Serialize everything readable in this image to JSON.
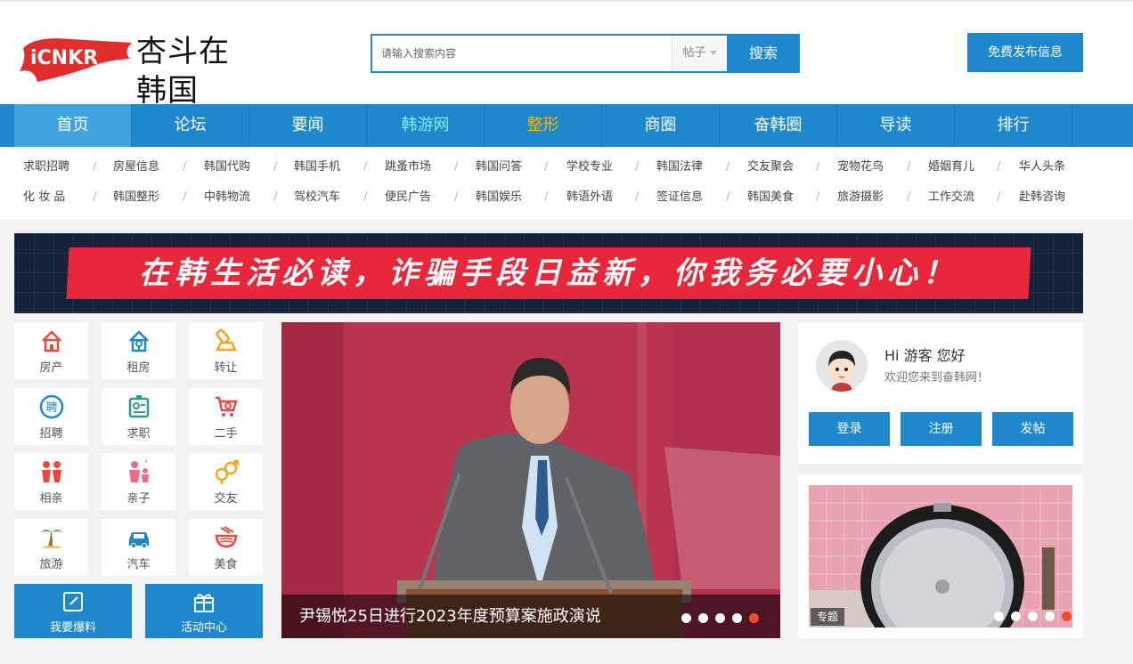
{
  "header": {
    "logo_mark": "iCNKR",
    "logo_text": "杏斗在韩国",
    "search_placeholder": "请输入搜索内容",
    "search_type": "帖子",
    "search_button": "搜索",
    "publish_button": "免费发布信息"
  },
  "nav": {
    "items": [
      {
        "label": "首页",
        "color": "#ffffff"
      },
      {
        "label": "论坛",
        "color": "#ffffff"
      },
      {
        "label": "要闻",
        "color": "#ffffff"
      },
      {
        "label": "韩游网",
        "color": "#7ff1ff"
      },
      {
        "label": "整形",
        "color": "#ffb400"
      },
      {
        "label": "商圈",
        "color": "#ffffff"
      },
      {
        "label": "奋韩圈",
        "color": "#ffffff"
      },
      {
        "label": "导读",
        "color": "#ffffff"
      },
      {
        "label": "排行",
        "color": "#ffffff"
      }
    ]
  },
  "subnav": {
    "row1": [
      "求职招聘",
      "房屋信息",
      "韩国代购",
      "韩国手机",
      "跳蚤市场",
      "韩国问答",
      "学校专业",
      "韩国法律",
      "交友聚会",
      "宠物花鸟",
      "婚姻育儿",
      "华人头条"
    ],
    "row2": [
      "化 妆 品",
      "韩国整形",
      "中韩物流",
      "驾校汽车",
      "便民广告",
      "韩国娱乐",
      "韩语外语",
      "签证信息",
      "韩国美食",
      "旅游摄影",
      "工作交流",
      "赴韩咨询"
    ],
    "separator": "/"
  },
  "banner": {
    "text": "在韩生活必读，诈骗手段日益新，你我务必要小心！"
  },
  "quick_tiles": [
    {
      "label": "房产",
      "icon": "house-icon",
      "color": "#e94a3f"
    },
    {
      "label": "租房",
      "icon": "house-key-icon",
      "color": "#1e88cc"
    },
    {
      "label": "转让",
      "icon": "tools-icon",
      "color": "#f5a623"
    },
    {
      "label": "招聘",
      "icon": "recruit-badge-icon",
      "color": "#1e88cc"
    },
    {
      "label": "求职",
      "icon": "id-card-icon",
      "color": "#2a9d8f"
    },
    {
      "label": "二手",
      "icon": "cart-icon",
      "color": "#e94a3f"
    },
    {
      "label": "相亲",
      "icon": "couple-icon",
      "color": "#e94a3f"
    },
    {
      "label": "亲子",
      "icon": "parent-child-icon",
      "color": "#f06b8a"
    },
    {
      "label": "交友",
      "icon": "gender-icon",
      "color": "#f5a623"
    },
    {
      "label": "旅游",
      "icon": "palm-tree-icon",
      "color": "#4caf50"
    },
    {
      "label": "汽车",
      "icon": "car-icon",
      "color": "#1e88cc"
    },
    {
      "label": "美食",
      "icon": "bowl-icon",
      "color": "#e94a3f"
    }
  ],
  "action_buttons": [
    {
      "label": "我要爆料",
      "icon": "edit-icon"
    },
    {
      "label": "活动中心",
      "icon": "gift-icon"
    }
  ],
  "slider": {
    "caption": "尹锡悦25日进行2023年度预算案施政演说",
    "dot_count": 5,
    "active_dot": 5
  },
  "user": {
    "greeting": "Hi 游客 您好",
    "welcome": "欢迎您来到奋韩网！",
    "buttons": [
      "登录",
      "注册",
      "发帖"
    ]
  },
  "topic": {
    "tag": "专题",
    "dot_count": 5,
    "active_dot": 5
  }
}
